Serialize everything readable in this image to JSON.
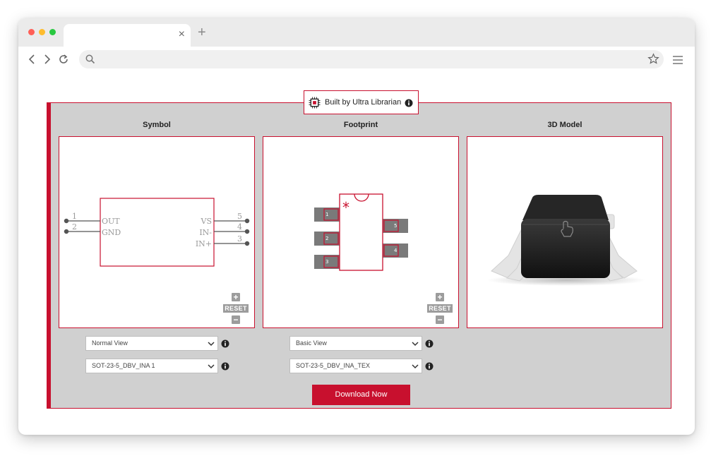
{
  "browser": {
    "tab_close": "×",
    "new_tab": "+"
  },
  "badge": {
    "text": "Built by Ultra Librarian"
  },
  "panels": {
    "symbol": {
      "title": "Symbol",
      "pins_left": [
        {
          "number": "1",
          "name": "OUT"
        },
        {
          "number": "2",
          "name": "GND"
        }
      ],
      "pins_right": [
        {
          "number": "5",
          "name": "VS"
        },
        {
          "number": "4",
          "name": "IN-"
        },
        {
          "number": "3",
          "name": "IN+"
        }
      ]
    },
    "footprint": {
      "title": "Footprint",
      "pads": [
        "1",
        "2",
        "3",
        "5",
        "4"
      ],
      "pin1_marker": "*"
    },
    "model_3d": {
      "title": "3D Model"
    }
  },
  "zoom": {
    "zoom_in": "+",
    "reset": "RESET",
    "zoom_out": "−"
  },
  "controls": {
    "symbol_view": "Normal View",
    "symbol_variant": "SOT-23-5_DBV_INA 1",
    "footprint_view": "Basic View",
    "footprint_variant": "SOT-23-5_DBV_INA_TEX"
  },
  "download": {
    "label": "Download Now"
  },
  "colors": {
    "accent": "#c8102e",
    "widget_bg": "#d0d0d0",
    "pad_gray": "#7a7a7a"
  }
}
